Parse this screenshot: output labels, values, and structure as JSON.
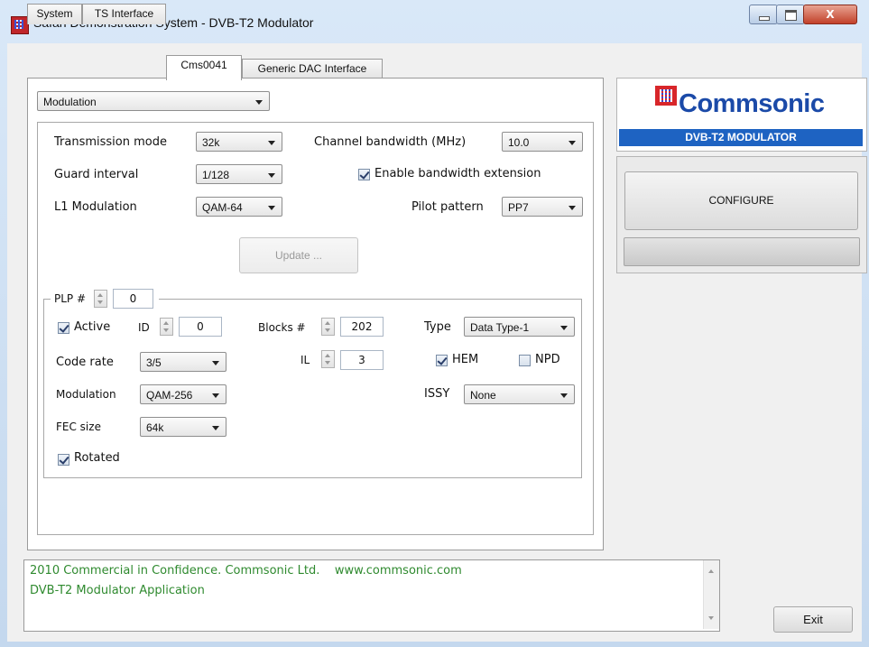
{
  "window": {
    "title": "Safari Demonstration System - DVB-T2 Modulator",
    "close_label": "X"
  },
  "tabs": [
    {
      "label": "System"
    },
    {
      "label": "TS Interface"
    },
    {
      "label": "Cms0041"
    },
    {
      "label": "Generic DAC Interface"
    }
  ],
  "view_select": {
    "value": "Modulation"
  },
  "settings": {
    "transmission_mode": {
      "label": "Transmission mode",
      "value": "32k"
    },
    "guard_interval": {
      "label": "Guard interval",
      "value": "1/128"
    },
    "l1_modulation": {
      "label": "L1 Modulation",
      "value": "QAM-64"
    },
    "channel_bandwidth": {
      "label": "Channel bandwidth (MHz)",
      "value": "10.0"
    },
    "enable_bandwidth_extension": {
      "label": "Enable bandwidth extension",
      "checked": true
    },
    "pilot_pattern": {
      "label": "Pilot pattern",
      "value": "PP7"
    },
    "update_label": "Update ..."
  },
  "plp": {
    "label": "PLP #",
    "index": "0",
    "active": {
      "label": "Active",
      "checked": true
    },
    "id": {
      "label": "ID",
      "value": "0"
    },
    "blocks": {
      "label": "Blocks #",
      "value": "202"
    },
    "type": {
      "label": "Type",
      "value": "Data Type-1"
    },
    "code_rate": {
      "label": "Code rate",
      "value": "3/5"
    },
    "il": {
      "label": "IL",
      "value": "3"
    },
    "hem": {
      "label": "HEM",
      "checked": true
    },
    "npd": {
      "label": "NPD",
      "checked": false
    },
    "modulation": {
      "label": "Modulation",
      "value": "QAM-256"
    },
    "issy": {
      "label": "ISSY",
      "value": "None"
    },
    "fec_size": {
      "label": "FEC size",
      "value": "64k"
    },
    "rotated": {
      "label": "Rotated",
      "checked": true
    }
  },
  "logo": {
    "name": "Commsonic",
    "subtitle": "DVB-T2 MODULATOR"
  },
  "configure_label": "CONFIGURE",
  "log": {
    "lines": [
      "2010 Commercial in Confidence. Commsonic Ltd.    www.commsonic.com",
      "DVB-T2 Modulator Application"
    ]
  },
  "exit_label": "Exit"
}
